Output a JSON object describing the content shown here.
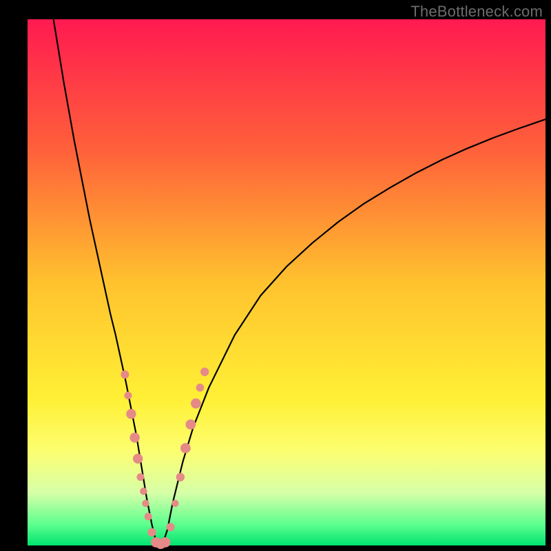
{
  "watermark": "TheBottleneck.com",
  "chart_data": {
    "type": "line",
    "title": "",
    "xlabel": "",
    "ylabel": "",
    "xlim": [
      0,
      100
    ],
    "ylim": [
      0,
      100
    ],
    "background_gradient": {
      "stops": [
        {
          "offset": 0,
          "color": "#ff1a50"
        },
        {
          "offset": 25,
          "color": "#ff613a"
        },
        {
          "offset": 50,
          "color": "#ffc22e"
        },
        {
          "offset": 72,
          "color": "#fff035"
        },
        {
          "offset": 82,
          "color": "#fdfe70"
        },
        {
          "offset": 90,
          "color": "#d6ffa8"
        },
        {
          "offset": 96,
          "color": "#5dff8e"
        },
        {
          "offset": 100,
          "color": "#00e36f"
        }
      ]
    },
    "frame": {
      "top_inset_pct": 3.5,
      "left_inset_pct": 5.0,
      "right_inset_pct": 1.0,
      "bottom_inset_pct": 1.0,
      "border_color": "#000000"
    },
    "series": [
      {
        "name": "bottleneck-curve",
        "stroke": "#000000",
        "stroke_width": 2.2,
        "x": [
          5,
          6,
          7,
          8,
          9,
          10,
          11,
          12,
          13,
          14,
          15,
          16,
          17,
          18,
          19,
          20,
          21,
          22,
          23,
          24,
          25,
          26,
          27,
          28,
          30,
          32,
          35,
          40,
          45,
          50,
          55,
          60,
          65,
          70,
          75,
          80,
          85,
          90,
          95,
          100
        ],
        "y": [
          100,
          94,
          88,
          82.5,
          77,
          72,
          67,
          62,
          57.5,
          53,
          48.5,
          44,
          40,
          35.5,
          31,
          26,
          21,
          15,
          9,
          4,
          0,
          0,
          3,
          8,
          16,
          22.5,
          30,
          40,
          47.5,
          53,
          57.5,
          61.5,
          65,
          68,
          70.8,
          73.3,
          75.5,
          77.5,
          79.3,
          81
        ]
      }
    ],
    "markers": {
      "color": "#e58a87",
      "stroke": "#7a2f2e",
      "points": [
        {
          "x": 18.8,
          "y": 32.5,
          "r": 6
        },
        {
          "x": 19.4,
          "y": 28.5,
          "r": 5.5
        },
        {
          "x": 20.0,
          "y": 25.0,
          "r": 7.2
        },
        {
          "x": 20.7,
          "y": 20.5,
          "r": 7.2
        },
        {
          "x": 21.3,
          "y": 16.5,
          "r": 7.2
        },
        {
          "x": 21.8,
          "y": 13.0,
          "r": 5.5
        },
        {
          "x": 22.4,
          "y": 10.3,
          "r": 5.3
        },
        {
          "x": 22.8,
          "y": 8.0,
          "r": 5.2
        },
        {
          "x": 23.3,
          "y": 5.5,
          "r": 5.5
        },
        {
          "x": 24.0,
          "y": 2.5,
          "r": 6.2
        },
        {
          "x": 24.8,
          "y": 0.6,
          "r": 7.4
        },
        {
          "x": 25.7,
          "y": 0.3,
          "r": 7.4
        },
        {
          "x": 26.6,
          "y": 0.6,
          "r": 7.4
        },
        {
          "x": 27.6,
          "y": 3.5,
          "r": 6.0
        },
        {
          "x": 28.5,
          "y": 8.0,
          "r": 5.2
        },
        {
          "x": 29.5,
          "y": 13.0,
          "r": 6.2
        },
        {
          "x": 30.5,
          "y": 18.5,
          "r": 7.4
        },
        {
          "x": 31.5,
          "y": 23.0,
          "r": 7.4
        },
        {
          "x": 32.5,
          "y": 27.0,
          "r": 7.4
        },
        {
          "x": 33.3,
          "y": 30.0,
          "r": 5.8
        },
        {
          "x": 34.2,
          "y": 33.0,
          "r": 6.2
        }
      ]
    }
  }
}
